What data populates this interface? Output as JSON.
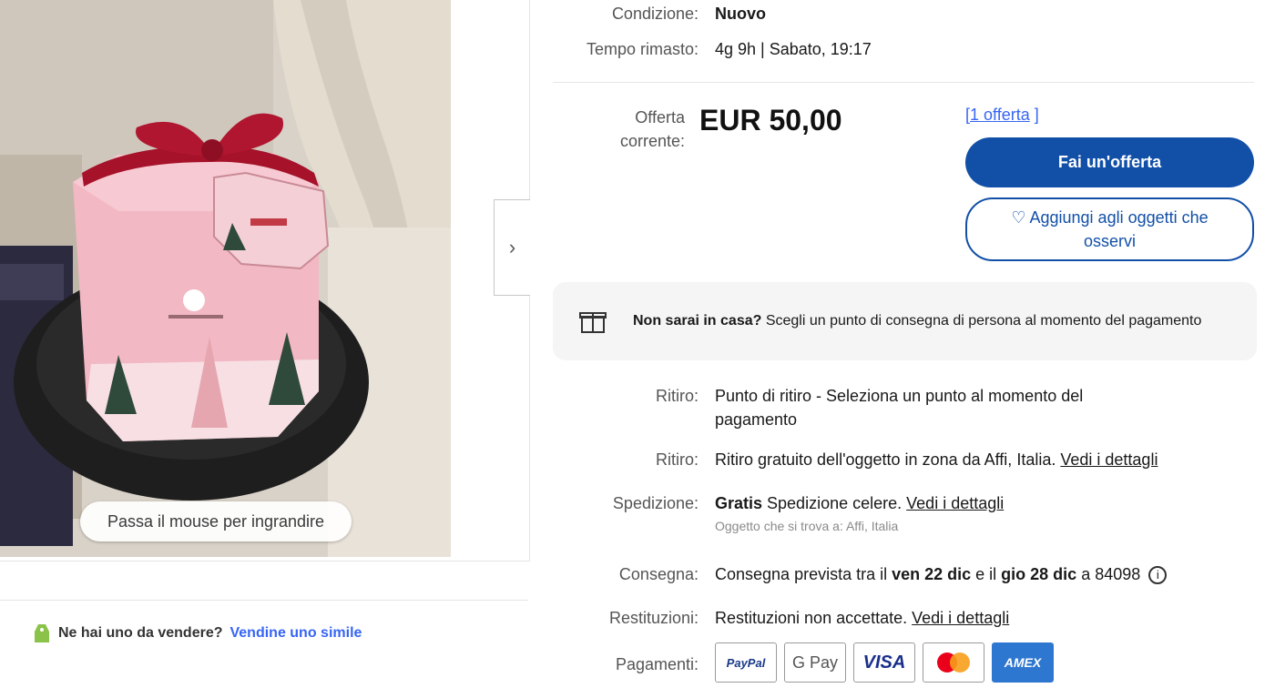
{
  "item": {
    "condition_label": "Condizione:",
    "condition_value": "Nuovo",
    "time_left_label": "Tempo rimasto:",
    "time_left_value": "4g 9h | Sabato, 19:17"
  },
  "bid": {
    "label": "Offerta corrente:",
    "price": "EUR 50,00",
    "bids_open": "[",
    "bids_link": "1 offerta",
    "bids_close": " ]",
    "place_bid_label": "Fai un'offerta",
    "watch_label": "Aggiungi agli oggetti che osservi",
    "watch_icon": "heart-icon"
  },
  "pickup_notice": {
    "icon": "gift-icon",
    "bold": "Non sarai in casa?",
    "text": " Scegli un punto di consegna di persona al momento del pagamento"
  },
  "shipping": {
    "pickup1_label": "Ritiro:",
    "pickup1_value": "Punto di ritiro - Seleziona un punto al momento del pagamento",
    "pickup2_label": "Ritiro:",
    "pickup2_value": "Ritiro gratuito dell'oggetto in zona da Affi, Italia.",
    "pickup2_link": "Vedi i dettagli",
    "shipping_label": "Spedizione:",
    "shipping_bold": "Gratis",
    "shipping_value": " Spedizione celere.",
    "shipping_link": "Vedi i dettagli",
    "shipping_location": "Oggetto che si trova a: Affi, Italia",
    "delivery_label": "Consegna:",
    "delivery_pre": "Consegna prevista tra il ",
    "delivery_from": "ven 22 dic",
    "delivery_mid": " e il ",
    "delivery_to": "gio 28 dic",
    "delivery_post": " a 84098",
    "delivery_icon": "info-icon",
    "returns_label": "Restituzioni:",
    "returns_value": "Restituzioni non accettate.",
    "returns_link": "Vedi i dettagli",
    "payments_label": "Pagamenti:",
    "payments": [
      "PayPal",
      "G Pay",
      "VISA",
      "Mastercard",
      "AMEX"
    ]
  },
  "gallery": {
    "zoom_hint": "Passa il mouse per ingrandire",
    "next_icon": "chevron-right-icon"
  },
  "sell_similar": {
    "icon": "tag-icon",
    "question": "Ne hai uno da vendere?",
    "link": "Vendine uno simile"
  }
}
